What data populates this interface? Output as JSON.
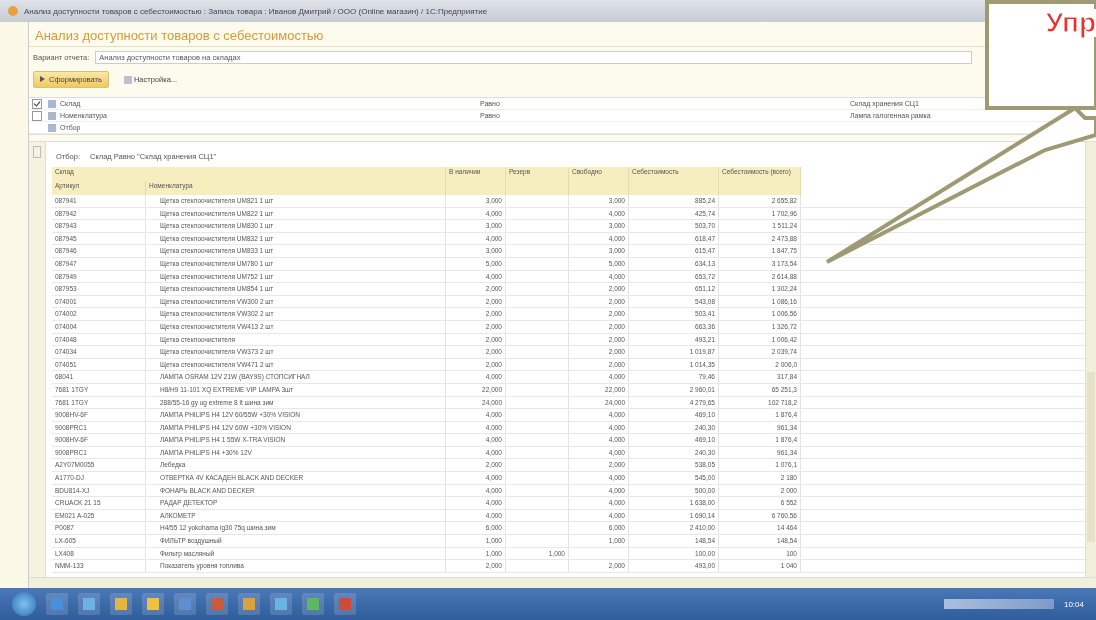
{
  "window": {
    "title": "Анализ доступности товаров с себестоимостью : Запись товара : Иванов Дмитрий / ООО (Online магазин) / 1С:Предприятие"
  },
  "report": {
    "title": "Анализ доступности товаров с себестоимостью",
    "variant_label": "Вариант отчета:",
    "variant_value": "Анализ доступности товаров на складах"
  },
  "buttons": [
    {
      "label": "Сформировать",
      "kind": "primary"
    },
    {
      "label": "Настройка...",
      "kind": "settings"
    }
  ],
  "filters": [
    {
      "checked": true,
      "field": "Склад",
      "condition": "Равно",
      "value": "Склад хранения СЦ1"
    },
    {
      "checked": false,
      "field": "Номенклатура",
      "condition": "Равно",
      "value": "Лампа галогенная рамка"
    },
    {
      "field": "Отбор"
    }
  ],
  "filter_caption": "Отбор:",
  "filter_text": "Склад Равно \"Склад хранения СЦ1\"",
  "table": {
    "group_header": "Склад",
    "columns": [
      "Артикул",
      "Номенклатура",
      "В наличии",
      "Резерв",
      "Свободно",
      "Себестоимость",
      "Себестоимость (всего)"
    ],
    "rows": [
      [
        "087941",
        "Щетка стеклоочистителя UM821 1 шт",
        "3,000",
        "",
        "3,000",
        "885,24",
        "2 655,82"
      ],
      [
        "087942",
        "Щетка стеклоочистителя UM822 1 шт",
        "4,000",
        "",
        "4,000",
        "425,74",
        "1 702,96"
      ],
      [
        "087943",
        "Щетка стеклоочистителя UM830 1 шт",
        "3,000",
        "",
        "3,000",
        "503,70",
        "1 511,24"
      ],
      [
        "087945",
        "Щетка стеклоочистителя UM832 1 шт",
        "4,000",
        "",
        "4,000",
        "618,47",
        "2 473,88"
      ],
      [
        "087946",
        "Щетка стеклоочистителя UM833 1 шт",
        "3,000",
        "",
        "3,000",
        "615,47",
        "1 847,75"
      ],
      [
        "087947",
        "Щетка стеклоочистителя UM780 1 шт",
        "5,000",
        "",
        "5,000",
        "634,13",
        "3 173,54"
      ],
      [
        "087949",
        "Щетка стеклоочистителя UM752 1 шт",
        "4,000",
        "",
        "4,000",
        "653,72",
        "2 614,88"
      ],
      [
        "087953",
        "Щетка стеклоочистителя UM854 1 шт",
        "2,000",
        "",
        "2,000",
        "651,12",
        "1 302,24"
      ],
      [
        "074001",
        "Щетка стеклоочистителя VW300 2 шт",
        "2,000",
        "",
        "2,000",
        "543,08",
        "1 086,16"
      ],
      [
        "074002",
        "Щетка стеклоочистителя VW302 2 шт",
        "2,000",
        "",
        "2,000",
        "503,41",
        "1 006,56"
      ],
      [
        "074004",
        "Щетка стеклоочистителя VW413 2 шт",
        "2,000",
        "",
        "2,000",
        "663,36",
        "1 326,72"
      ],
      [
        "074048",
        "Щетка стеклоочистителя",
        "2,000",
        "",
        "2,000",
        "493,21",
        "1 006,42"
      ],
      [
        "074034",
        "Щетка стеклоочистителя VW373 2 шт",
        "2,000",
        "",
        "2,000",
        "1 019,87",
        "2 039,74"
      ],
      [
        "074051",
        "Щетка стеклоочистителя VW471 2 шт",
        "2,000",
        "",
        "2,000",
        "1 014,35",
        "2 006,0"
      ],
      [
        "68041",
        "ЛАМПА OSRAM 12V 21W (BAY9S) СТОПСИГНАЛ",
        "4,000",
        "",
        "4,000",
        "79,46",
        "317,84"
      ],
      [
        "7681 1TGY",
        "H8/H9 11-101 XQ EXTREME VIP LAMPA 3шт",
        "22,000",
        "",
        "22,000",
        "2 960,01",
        "65 251,3"
      ],
      [
        "7681 1TGY",
        "288/55-16 gy ug extreme 8 lt шина зим",
        "24,000",
        "",
        "24,000",
        "4 279,65",
        "102 718,2"
      ],
      [
        "9008HV-6F",
        "ЛАМПА PHILIPS H4 12V 60/55W +30% VISION",
        "4,000",
        "",
        "4,000",
        "469,10",
        "1 876,4"
      ],
      [
        "9008PRC1",
        "ЛАМПА PHILIPS H4 12V 60W +30% VISION",
        "4,000",
        "",
        "4,000",
        "240,30",
        "961,34"
      ],
      [
        "9008HV-6F",
        "ЛАМПА PHILIPS H4 1 55W X-TRA VISION",
        "4,000",
        "",
        "4,000",
        "469,10",
        "1 876,4"
      ],
      [
        "9008PRC1",
        "ЛАМПА PHILIPS H4 +30% 12V",
        "4,000",
        "",
        "4,000",
        "240,30",
        "961,34"
      ],
      [
        "A2Y07M0055",
        "Лебедка",
        "2,000",
        "",
        "2,000",
        "538,05",
        "1 076,1"
      ],
      [
        "A1770-DJ",
        "ОТВЕРТКА 4V КАСАДЕН BLACK AND DECKER",
        "4,000",
        "",
        "4,000",
        "545,00",
        "2 180"
      ],
      [
        "BDU814-XJ",
        "ФОНАРЬ BLACK AND DECKER",
        "4,000",
        "",
        "4,000",
        "500,00",
        "2 000"
      ],
      [
        "CRUACK 21 15",
        "РАДАР ДЕТЕКТОР",
        "4,000",
        "",
        "4,000",
        "1 638,00",
        "6 552"
      ],
      [
        "EM021 A-025",
        "АЛКОМЕТР",
        "4,000",
        "",
        "4,000",
        "1 690,14",
        "6 760,56"
      ],
      [
        "P0087",
        "H4/55 12 yokohama ig30 75q шина зим",
        "6,000",
        "",
        "6,000",
        "2 410,00",
        "14 464"
      ],
      [
        "LX-605",
        "ФИЛЬТР воздушный",
        "1,000",
        "",
        "1,000",
        "148,54",
        "148,54"
      ],
      [
        "LX408",
        "Фильтр масляный",
        "1,000",
        "1,000",
        "",
        "100,00",
        "100"
      ],
      [
        "NMM-133",
        "Показатель уровня топлива",
        "2,000",
        "",
        "2,000",
        "493,00",
        "1 040"
      ]
    ]
  },
  "callout": {
    "text": "Упр"
  },
  "taskbar": {
    "clock": "10:04"
  }
}
